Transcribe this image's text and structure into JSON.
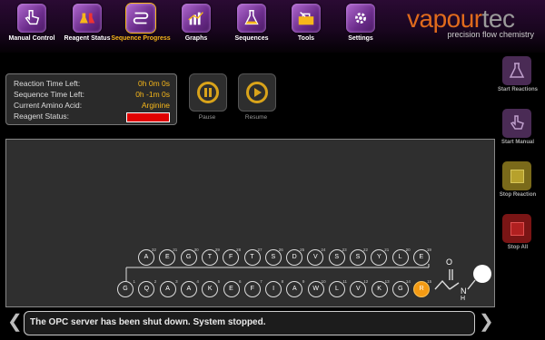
{
  "nav": [
    {
      "id": "manual",
      "label": "Manual Control",
      "icon": "hand-pointer-icon"
    },
    {
      "id": "reagent",
      "label": "Reagent Status",
      "icon": "flasks-icon"
    },
    {
      "id": "sequence",
      "label": "Sequence Progress",
      "icon": "sequence-progress-icon",
      "active": true
    },
    {
      "id": "graphs",
      "label": "Graphs",
      "icon": "bar-graph-icon"
    },
    {
      "id": "sequences",
      "label": "Sequences",
      "icon": "flask-list-icon"
    },
    {
      "id": "tools",
      "label": "Tools",
      "icon": "toolbox-icon"
    },
    {
      "id": "settings",
      "label": "Settings",
      "icon": "gear-icon"
    }
  ],
  "brand": {
    "logo_a": "vapour",
    "logo_b": "tec",
    "tagline": "precision flow chemistry"
  },
  "status": {
    "reaction_time_label": "Reaction Time Left:",
    "reaction_time_value": "0h 0m 0s",
    "sequence_time_label": "Sequence Time Left:",
    "sequence_time_value": "0h -1m 0s",
    "amino_acid_label": "Current Amino Acid:",
    "amino_acid_value": "Arginine",
    "reagent_label": "Reagent Status:",
    "reagent_status_color": "#e00000"
  },
  "controls": {
    "pause_label": "Pause",
    "resume_label": "Resume"
  },
  "sidebar": {
    "start_reactions": "Start Reactions",
    "start_manual": "Start Manual",
    "stop_reaction": "Stop Reaction",
    "stop_all": "Stop All"
  },
  "sequence": {
    "top_row": [
      {
        "letter": "A",
        "num": "32"
      },
      {
        "letter": "E",
        "num": "31"
      },
      {
        "letter": "G",
        "num": "30"
      },
      {
        "letter": "T",
        "num": "29"
      },
      {
        "letter": "F",
        "num": "28"
      },
      {
        "letter": "T",
        "num": "27"
      },
      {
        "letter": "S",
        "num": "26"
      },
      {
        "letter": "D",
        "num": "25"
      },
      {
        "letter": "V",
        "num": "24"
      },
      {
        "letter": "S",
        "num": "23"
      },
      {
        "letter": "S",
        "num": "22"
      },
      {
        "letter": "Y",
        "num": "21"
      },
      {
        "letter": "L",
        "num": "20"
      },
      {
        "letter": "E",
        "num": "19"
      }
    ],
    "bottom_row": [
      {
        "letter": "G",
        "num": "1"
      },
      {
        "letter": "Q",
        "num": "2"
      },
      {
        "letter": "A",
        "num": "3"
      },
      {
        "letter": "A",
        "num": "4"
      },
      {
        "letter": "K",
        "num": "5"
      },
      {
        "letter": "E",
        "num": "6"
      },
      {
        "letter": "F",
        "num": "7"
      },
      {
        "letter": "I",
        "num": "8"
      },
      {
        "letter": "A",
        "num": "9"
      },
      {
        "letter": "W",
        "num": "10"
      },
      {
        "letter": "L",
        "num": "11"
      },
      {
        "letter": "V",
        "num": "12"
      },
      {
        "letter": "K",
        "num": "13"
      },
      {
        "letter": "G",
        "num": "14"
      },
      {
        "letter": "R",
        "num": "15",
        "current": true
      }
    ],
    "linker_labels": {
      "oxygen": "O",
      "amine": "N",
      "hydrogen": "H"
    }
  },
  "message": "The OPC server has been shut down. System stopped."
}
